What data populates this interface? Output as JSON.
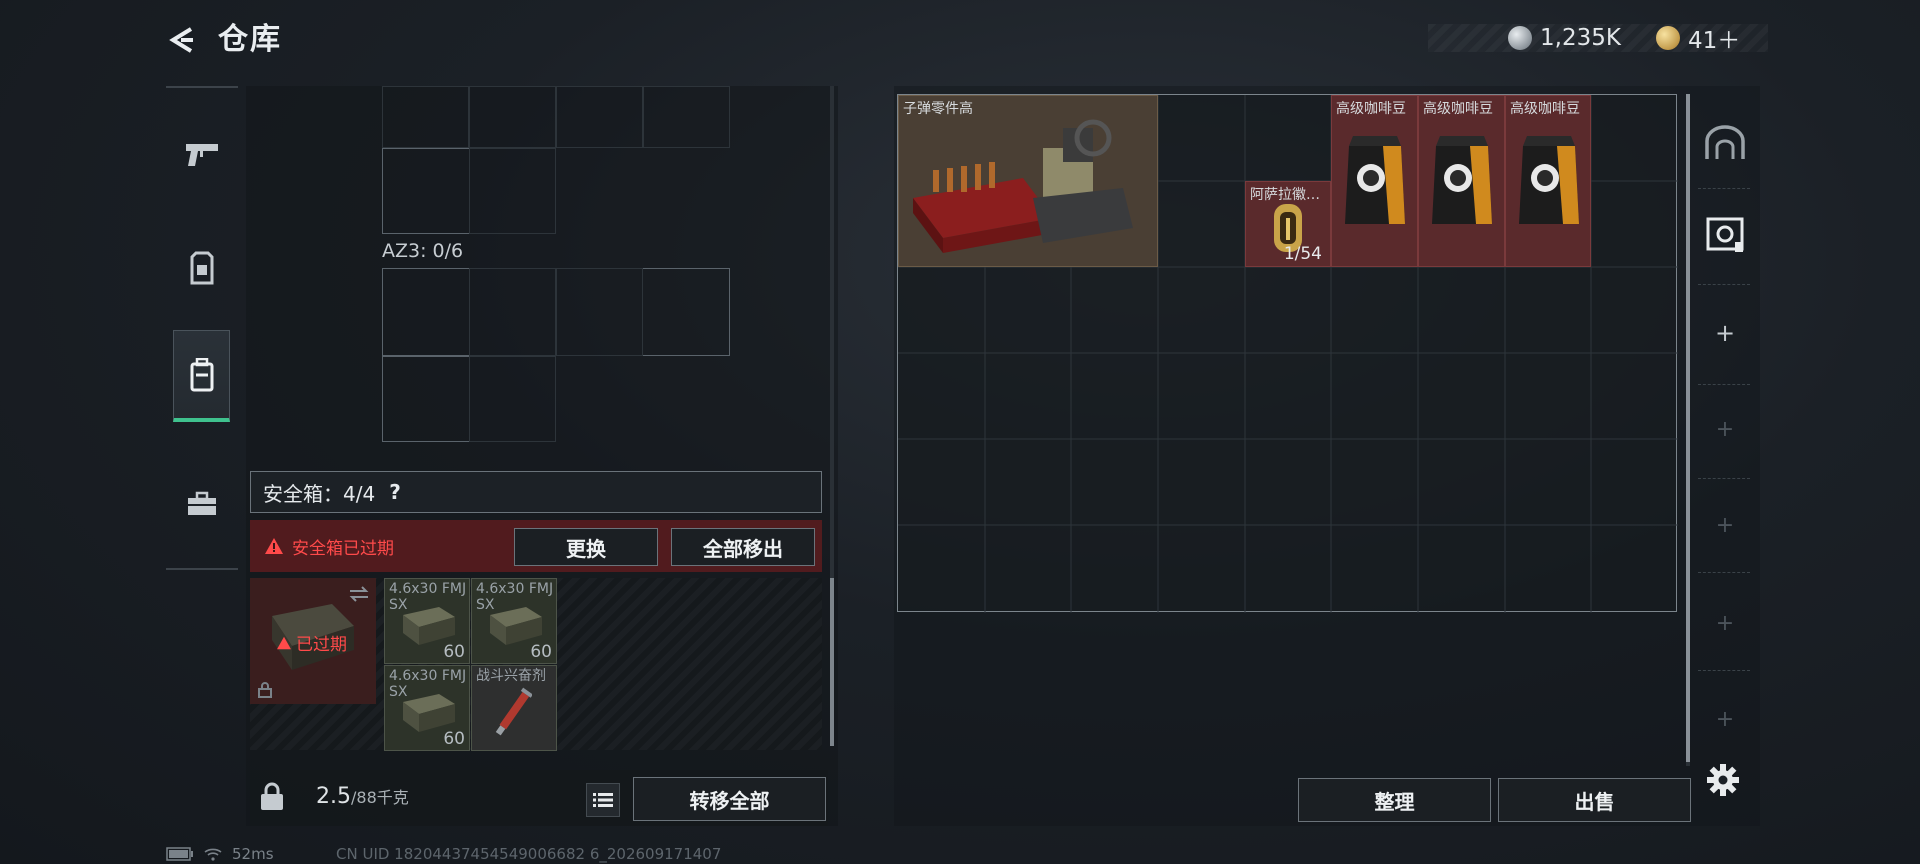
{
  "header": {
    "title": "仓库",
    "currency_silver": "1,235K",
    "currency_gold": "41＋"
  },
  "left_nav": {
    "items": [
      "weapon-icon",
      "armor-icon",
      "backpack-icon",
      "toolbox-icon"
    ],
    "active": "backpack-icon"
  },
  "loadout": {
    "az3_label": "AZ3: 0/6"
  },
  "safe_box": {
    "label": "安全箱：4/4",
    "help": "?",
    "expired_warning": "安全箱已过期",
    "expired_badge": "已过期",
    "replace_button": "更换",
    "remove_all_button": "全部移出",
    "slots": [
      {
        "name": "4.6x30 FMJ SX",
        "count": "60"
      },
      {
        "name": "4.6x30 FMJ SX",
        "count": "60"
      },
      {
        "name": "4.6x30 FMJ SX",
        "count": "60"
      },
      {
        "name": "战斗兴奋剂",
        "count": ""
      }
    ]
  },
  "weight": {
    "current": "2.5",
    "max": "/88千克"
  },
  "transfer_all_button": "转移全部",
  "storage": {
    "items": [
      {
        "name": "子弹零件高",
        "count": ""
      },
      {
        "name": "阿萨拉徽…",
        "count": "1/54"
      },
      {
        "name": "高级咖啡豆",
        "count": ""
      },
      {
        "name": "高级咖啡豆",
        "count": ""
      },
      {
        "name": "高级咖啡豆",
        "count": ""
      }
    ]
  },
  "right_tools": {
    "add_labels": [
      "+",
      "+",
      "+",
      "+",
      "+",
      "+"
    ]
  },
  "bottom_buttons": {
    "sort": "整理",
    "sell": "出售"
  },
  "status_bar": {
    "ping": "52ms",
    "uid": "CN UID 18204437454549006682 6_202609171407"
  },
  "colors": {
    "accent_green": "#3fc28e",
    "warning_red": "#ff4a4a",
    "item_bg_red": "#5a2a2c",
    "item_bg_gold": "#4a3a2c"
  }
}
